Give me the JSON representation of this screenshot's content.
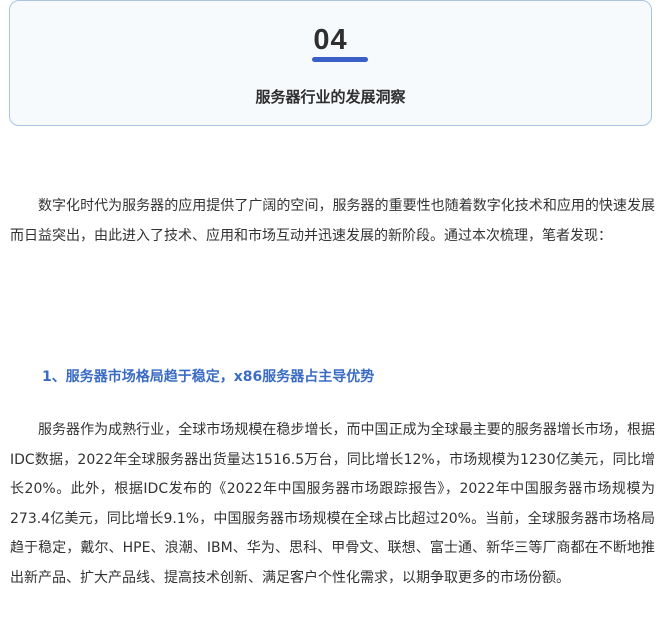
{
  "header": {
    "section_number": "04",
    "section_title": "服务器行业的发展洞察"
  },
  "intro": {
    "paragraph": "数字化时代为服务器的应用提供了广阔的空间，服务器的重要性也随着数字化技术和应用的快速发展而日益突出，由此进入了技术、应用和市场互动并迅速发展的新阶段。通过本次梳理，笔者发现："
  },
  "section_1": {
    "heading": "1、服务器市场格局趋于稳定，x86服务器占主导优势",
    "paragraph": "服务器作为成熟行业，全球市场规模在稳步增长，而中国正成为全球最主要的服务器增长市场，根据IDC数据，2022年全球服务器出货量达1516.5万台，同比增长12%，市场规模为1230亿美元，同比增长20%。此外，根据IDC发布的《2022年中国服务器市场跟踪报告》，2022年中国服务器市场规模为273.4亿美元，同比增长9.1%，中国服务器市场规模在全球占比超过20%。当前，全球服务器市场格局趋于稳定，戴尔、HPE、浪潮、IBM、华为、思科、甲骨文、联想、富士通、新华三等厂商都在不断地推出新产品、扩大产品线、提高技术创新、满足客户个性化需求，以期争取更多的市场份额。"
  }
}
